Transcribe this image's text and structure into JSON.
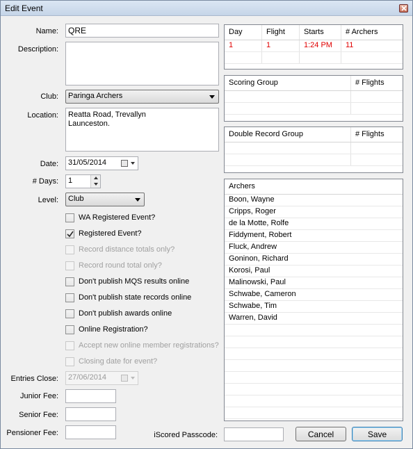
{
  "window": {
    "title": "Edit Event"
  },
  "form": {
    "name_label": "Name:",
    "name_value": "QRE",
    "description_label": "Description:",
    "description_value": "",
    "club_label": "Club:",
    "club_value": "Paringa Archers",
    "location_label": "Location:",
    "location_value": "Reatta Road, Trevallyn\nLaunceston.",
    "date_label": "Date:",
    "date_value": "31/05/2014",
    "days_label": "# Days:",
    "days_value": "1",
    "level_label": "Level:",
    "level_value": "Club",
    "entries_close_label": "Entries Close:",
    "entries_close_value": "27/06/2014",
    "junior_fee_label": "Junior Fee:",
    "junior_fee_value": "",
    "senior_fee_label": "Senior Fee:",
    "senior_fee_value": "",
    "pensioner_fee_label": "Pensioner Fee:",
    "pensioner_fee_value": "",
    "iscored_label": "iScored Passcode:",
    "iscored_value": ""
  },
  "checkboxes": [
    {
      "label": "WA Registered Event?",
      "checked": false,
      "enabled": true
    },
    {
      "label": "Registered Event?",
      "checked": true,
      "enabled": true
    },
    {
      "label": "Record distance totals only?",
      "checked": false,
      "enabled": false
    },
    {
      "label": "Record round total only?",
      "checked": false,
      "enabled": false
    },
    {
      "label": "Don't publish MQS results online",
      "checked": false,
      "enabled": true
    },
    {
      "label": "Don't publish state records online",
      "checked": false,
      "enabled": true
    },
    {
      "label": "Don't publish awards online",
      "checked": false,
      "enabled": true
    },
    {
      "label": "Online Registration?",
      "checked": false,
      "enabled": true
    },
    {
      "label": "Accept new online member registrations?",
      "checked": false,
      "enabled": false
    },
    {
      "label": "Closing date for event?",
      "checked": false,
      "enabled": false
    }
  ],
  "flights_grid": {
    "headers": [
      "Day",
      "Flight",
      "Starts",
      "# Archers"
    ],
    "rows": [
      [
        "1",
        "1",
        "1:24 PM",
        "11"
      ]
    ]
  },
  "scoring_grid": {
    "headers": [
      "Scoring Group",
      "# Flights"
    ]
  },
  "double_grid": {
    "headers": [
      "Double Record Group",
      "# Flights"
    ]
  },
  "archers": {
    "header": "Archers",
    "items": [
      "Boon, Wayne",
      "Cripps, Roger",
      "de la Motte, Rolfe",
      "Fiddyment, Robert",
      "Fluck, Andrew",
      "Goninon, Richard",
      "Korosi, Paul",
      "Malinowski, Paul",
      "Schwabe, Cameron",
      "Schwabe, Tim",
      "Warren, David"
    ]
  },
  "buttons": {
    "cancel": "Cancel",
    "save": "Save"
  },
  "colors": {
    "highlight_row_text": "#e00000",
    "title_bar": "#c5d5e8",
    "window_bg": "#f0f0f0"
  }
}
